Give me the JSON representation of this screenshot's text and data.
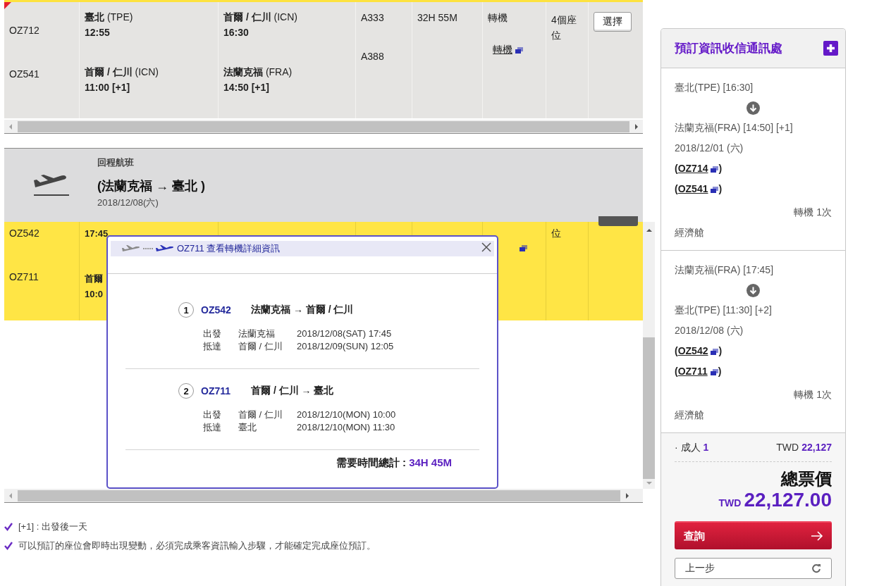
{
  "outbound_table": {
    "flights": [
      {
        "flight": "OZ712",
        "departure": "**臺北** (TPE)",
        "departure_time": "12:55",
        "arrival": "**首爾 / 仁川** (ICN)",
        "arrival_time": "16:30",
        "aircraft": "A333"
      },
      {
        "flight": "OZ541",
        "departure": "**首爾 / 仁川** (ICN)",
        "departure_time": "11:00 [+1]",
        "arrival": "**法蘭克福** (FRA)",
        "arrival_time": "14:50 [+1]",
        "aircraft": "A388"
      }
    ],
    "duration": "32H 55M",
    "transfer": "轉機",
    "transfer_link": "轉機",
    "seats": "4個座位",
    "select_button": "選擇"
  },
  "return_header": {
    "label": "回程航班",
    "route": "(法蘭克福 → 臺北 )",
    "date": "2018/12/08(六)"
  },
  "return_table": {
    "rows": [
      {
        "flight": "OZ542",
        "departure_time": "17:45",
        "seats": "位"
      },
      {
        "flight": "OZ711",
        "departure_city": "首爾",
        "departure_time": "10:0"
      }
    ]
  },
  "transfer_popup": {
    "title": "OZ711 查看轉機詳細資訊",
    "legs": [
      {
        "number": "1",
        "flight": "OZ542",
        "route": "法蘭克福 → 首爾 / 仁川",
        "departure_label": "出發",
        "departure_place": "法蘭克福",
        "departure_time": "2018/12/08(SAT) 17:45",
        "arrival_label": "抵達",
        "arrival_place": "首爾 / 仁川",
        "arrival_time": "2018/12/09(SUN) 12:05"
      },
      {
        "number": "2",
        "flight": "OZ711",
        "route": "首爾 / 仁川 → 臺北",
        "departure_label": "出發",
        "departure_place": "首爾 / 仁川",
        "departure_time": "2018/12/10(MON) 10:00",
        "arrival_label": "抵達",
        "arrival_place": "臺北",
        "arrival_time": "2018/12/10(MON) 11:30"
      }
    ],
    "total_label": "需要時間總計 :",
    "total_value": "34H 45M"
  },
  "notes": [
    "[+1] : 出發後一天",
    "可以預訂的座位會即時出現變動，必須完成乘客資訊輸入步驟，才能確定完成座位預訂。"
  ],
  "sidebar": {
    "title": "預訂資訊收信通訊處",
    "itineraries": [
      {
        "from": "臺北(TPE) [16:30]",
        "to": "法蘭克福(FRA) [14:50] [+1]",
        "date": "2018/12/01 (六)",
        "flights": [
          {
            "open": "(",
            "code": "OZ714",
            "close": ")"
          },
          {
            "open": "(",
            "code": "OZ541",
            "close": ")"
          }
        ],
        "transfers": "轉機 1次",
        "cabin": "經濟艙"
      },
      {
        "from": "法蘭克福(FRA) [17:45]",
        "to": "臺北(TPE) [11:30] [+2]",
        "date": "2018/12/08 (六)",
        "flights": [
          {
            "open": "(",
            "code": "OZ542",
            "close": ")"
          },
          {
            "open": "(",
            "code": "OZ711",
            "close": ")"
          }
        ],
        "transfers": "轉機 1次",
        "cabin": "經濟艙"
      }
    ],
    "passenger_label": "· 成人",
    "passenger_count": "1",
    "fare_currency": "TWD",
    "fare_amount": "22,127",
    "total_label": "總票價",
    "total_currency": "TWD",
    "total_amount": "22,127.00",
    "search_button": "查詢",
    "back_button": "上一步"
  }
}
